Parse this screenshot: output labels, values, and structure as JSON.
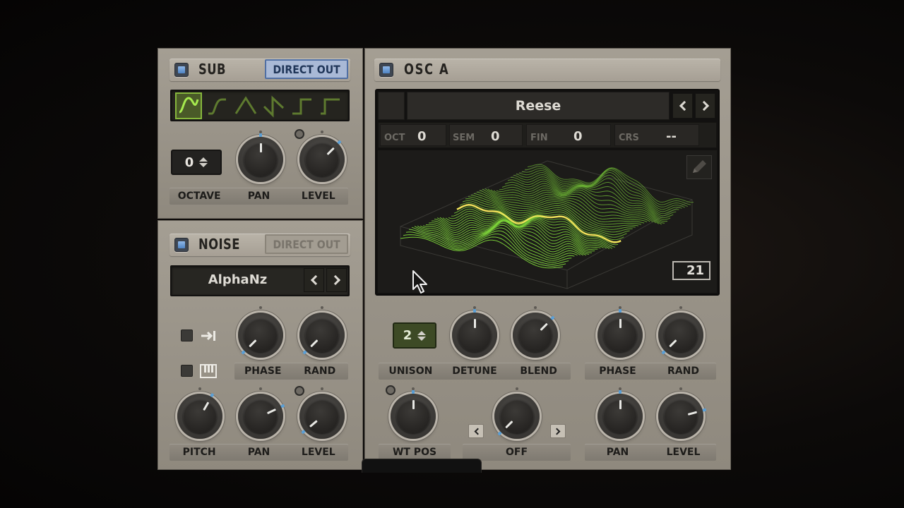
{
  "sub": {
    "title": "SUB",
    "direct_out": "DIRECT OUT",
    "shapes": [
      "sine-wave-icon",
      "rounded-ramp-icon",
      "triangle-wave-icon",
      "saw-wave-icon",
      "square-wave-icon",
      "pulse-wave-icon"
    ],
    "octave_value": "0",
    "labels": {
      "octave": "OCTAVE",
      "pan": "PAN",
      "level": "LEVEL"
    }
  },
  "noise": {
    "title": "NOISE",
    "direct_out": "DIRECT OUT",
    "preset": "AlphaNz",
    "labels": {
      "phase": "PHASE",
      "rand": "RAND",
      "pitch": "PITCH",
      "pan": "PAN",
      "level": "LEVEL"
    },
    "icons": [
      "one-shot-icon",
      "keytrack-icon"
    ]
  },
  "osc": {
    "title": "OSC A",
    "wavetable": "Reese",
    "params": [
      {
        "label": "OCT",
        "value": "0"
      },
      {
        "label": "SEM",
        "value": "0"
      },
      {
        "label": "FIN",
        "value": "0"
      },
      {
        "label": "CRS",
        "value": "--"
      }
    ],
    "frame": "21",
    "unison": "2",
    "labels": {
      "unison": "UNISON",
      "detune": "DETUNE",
      "blend": "BLEND",
      "phase": "PHASE",
      "rand": "RAND",
      "wt_pos": "WT POS",
      "warp": "OFF",
      "pan": "PAN",
      "level": "LEVEL"
    }
  },
  "colors": {
    "panel": "#9a9489",
    "waveform_green": "#7fd83a",
    "waveform_highlight": "#f0e45a",
    "checkbox_blue": "#5f93d3",
    "knob_tip": "#5a9fd6"
  }
}
